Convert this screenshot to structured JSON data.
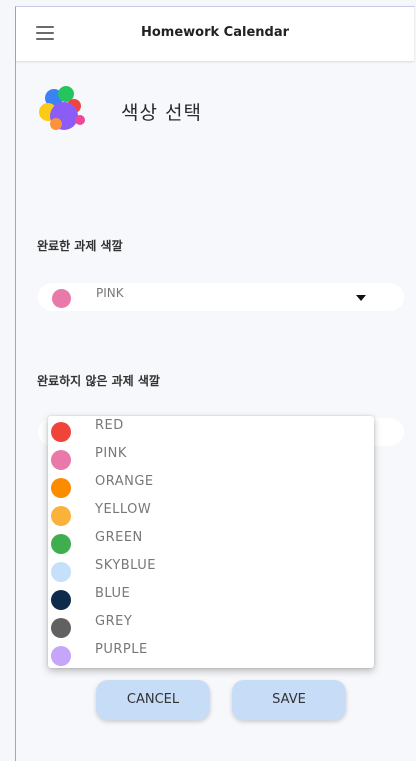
{
  "appbar": {
    "title": "Homework Calendar"
  },
  "header": {
    "title": "색상 선택"
  },
  "completed": {
    "label": "완료한 과제 색깔",
    "value": "PINK",
    "color": "#e879a8"
  },
  "incomplete": {
    "label": "완료하지 않은 과제 색깔"
  },
  "options": [
    {
      "label": "RED",
      "color": "#f0433a"
    },
    {
      "label": "PINK",
      "color": "#e879a8"
    },
    {
      "label": "ORANGE",
      "color": "#fb8c00"
    },
    {
      "label": "YELLOW",
      "color": "#fbb23a"
    },
    {
      "label": "GREEN",
      "color": "#3fae4f"
    },
    {
      "label": "SKYBLUE",
      "color": "#c6e0fb"
    },
    {
      "label": "BLUE",
      "color": "#0f2b4b"
    },
    {
      "label": "GREY",
      "color": "#616161"
    },
    {
      "label": "PURPLE",
      "color": "#c5a6fb"
    }
  ],
  "buttons": {
    "cancel": "CANCEL",
    "save": "SAVE"
  }
}
